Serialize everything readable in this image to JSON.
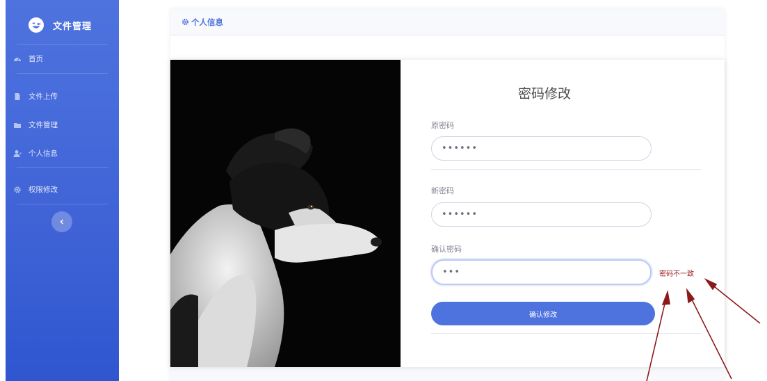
{
  "sidebar": {
    "brand": "文件管理",
    "items": [
      {
        "label": "首页",
        "icon": "dashboard-icon"
      },
      {
        "label": "文件上传",
        "icon": "file-icon"
      },
      {
        "label": "文件管理",
        "icon": "folder-icon"
      },
      {
        "label": "个人信息",
        "icon": "user-icon"
      },
      {
        "label": "权限修改",
        "icon": "gear-icon"
      }
    ],
    "toggle_icon": "chevron-left-icon"
  },
  "header": {
    "title": "个人信息",
    "icon": "gear-icon"
  },
  "form": {
    "title": "密码修改",
    "old_password": {
      "label": "原密码",
      "value": "••••••"
    },
    "new_password": {
      "label": "新密码",
      "value": "••••••"
    },
    "confirm_password": {
      "label": "确认密码",
      "value": "•••"
    },
    "error": "密码不一致",
    "submit_label": "确认修改"
  },
  "colors": {
    "primary": "#4e73df",
    "error": "#9b1c1c",
    "annotation_arrow": "#8b1a1a"
  }
}
